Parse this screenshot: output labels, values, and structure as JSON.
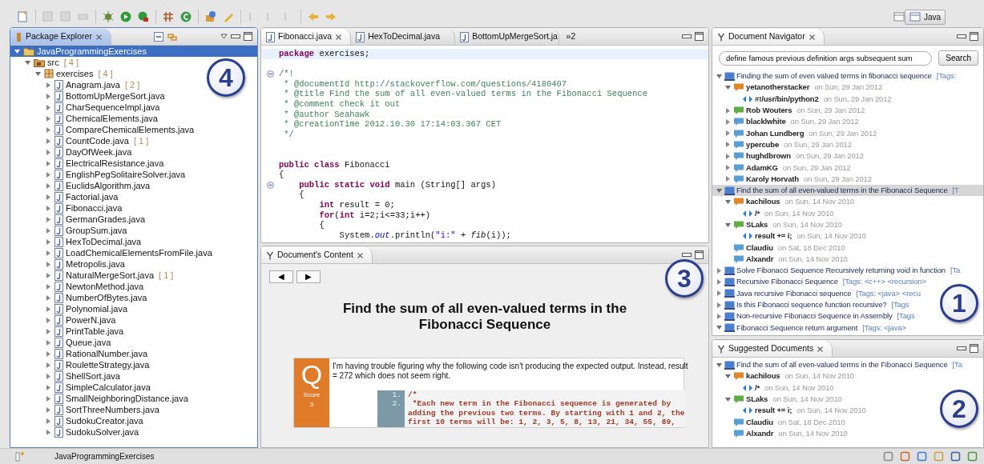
{
  "toolbar": {
    "perspective": "Java"
  },
  "package_explorer": {
    "title": "Package Explorer",
    "callout": "4",
    "tree": [
      {
        "kind": "project",
        "label": "JavaProgrammingExercises",
        "expanded": true,
        "selected": true,
        "children": [
          {
            "kind": "source-folder",
            "label": "src",
            "count": "[ 4 ]",
            "expanded": true,
            "selected": false,
            "children": [
              {
                "kind": "package",
                "label": "exercises",
                "count": "[ 4 ]",
                "expanded": true,
                "selected": false,
                "children": [
                  {
                    "kind": "java-file",
                    "label": "Anagram.java",
                    "count": "[ 2 ]",
                    "expanded": false,
                    "selected": false
                  },
                  {
                    "kind": "java-file",
                    "label": "BottomUpMergeSort.java",
                    "expanded": false,
                    "selected": false
                  },
                  {
                    "kind": "java-file",
                    "label": "CharSequenceImpl.java",
                    "expanded": false,
                    "selected": false
                  },
                  {
                    "kind": "java-file",
                    "label": "ChemicalElements.java",
                    "expanded": false,
                    "selected": false
                  },
                  {
                    "kind": "java-file",
                    "label": "CompareChemicalElements.java",
                    "expanded": false,
                    "selected": false
                  },
                  {
                    "kind": "java-file",
                    "label": "CountCode.java",
                    "count": "[ 1 ]",
                    "expanded": false,
                    "selected": false
                  },
                  {
                    "kind": "java-file",
                    "label": "DayOfWeek.java",
                    "expanded": false,
                    "selected": false
                  },
                  {
                    "kind": "java-file",
                    "label": "ElectricalResistance.java",
                    "expanded": false,
                    "selected": false
                  },
                  {
                    "kind": "java-file",
                    "label": "EnglishPegSolitaireSolver.java",
                    "expanded": false,
                    "selected": false
                  },
                  {
                    "kind": "java-file",
                    "label": "EuclidsAlgorithm.java",
                    "expanded": false,
                    "selected": false
                  },
                  {
                    "kind": "java-file",
                    "label": "Factorial.java",
                    "expanded": false,
                    "selected": false
                  },
                  {
                    "kind": "java-file",
                    "label": "Fibonacci.java",
                    "expanded": false,
                    "selected": false
                  },
                  {
                    "kind": "java-file",
                    "label": "GermanGrades.java",
                    "expanded": false,
                    "selected": false
                  },
                  {
                    "kind": "java-file",
                    "label": "GroupSum.java",
                    "expanded": false,
                    "selected": false
                  },
                  {
                    "kind": "java-file",
                    "label": "HexToDecimal.java",
                    "expanded": false,
                    "selected": false
                  },
                  {
                    "kind": "java-file",
                    "label": "LoadChemicalElementsFromFile.java",
                    "expanded": false,
                    "selected": false
                  },
                  {
                    "kind": "java-file",
                    "label": "Metropolis.java",
                    "expanded": false,
                    "selected": false
                  },
                  {
                    "kind": "java-file",
                    "label": "NaturalMergeSort.java",
                    "count": "[ 1 ]",
                    "expanded": false,
                    "selected": false
                  },
                  {
                    "kind": "java-file",
                    "label": "NewtonMethod.java",
                    "expanded": false,
                    "selected": false
                  },
                  {
                    "kind": "java-file",
                    "label": "NumberOfBytes.java",
                    "expanded": false,
                    "selected": false
                  },
                  {
                    "kind": "java-file",
                    "label": "Polynomial.java",
                    "expanded": false,
                    "selected": false
                  },
                  {
                    "kind": "java-file",
                    "label": "PowerN.java",
                    "expanded": false,
                    "selected": false
                  },
                  {
                    "kind": "java-file",
                    "label": "PrintTable.java",
                    "expanded": false,
                    "selected": false
                  },
                  {
                    "kind": "java-file",
                    "label": "Queue.java",
                    "expanded": false,
                    "selected": false
                  },
                  {
                    "kind": "java-file",
                    "label": "RationalNumber.java",
                    "expanded": false,
                    "selected": false
                  },
                  {
                    "kind": "java-file",
                    "label": "RouletteStrategy.java",
                    "expanded": false,
                    "selected": false
                  },
                  {
                    "kind": "java-file",
                    "label": "ShellSort.java",
                    "expanded": false,
                    "selected": false
                  },
                  {
                    "kind": "java-file",
                    "label": "SimpleCalculator.java",
                    "expanded": false,
                    "selected": false
                  },
                  {
                    "kind": "java-file",
                    "label": "SmallNeighboringDistance.java",
                    "expanded": false,
                    "selected": false
                  },
                  {
                    "kind": "java-file",
                    "label": "SortThreeNumbers.java",
                    "expanded": false,
                    "selected": false
                  },
                  {
                    "kind": "java-file",
                    "label": "SudokuCreator.java",
                    "expanded": false,
                    "selected": false
                  },
                  {
                    "kind": "java-file",
                    "label": "SudokuSolver.java",
                    "expanded": false,
                    "selected": false
                  }
                ]
              }
            ]
          }
        ]
      }
    ]
  },
  "editor": {
    "tabs": [
      {
        "label": "Fibonacci.java",
        "selected": true
      },
      {
        "label": "HexToDecimal.java",
        "selected": false
      },
      {
        "label": "BottomUpMergeSort.ja",
        "selected": false
      }
    ],
    "overflow": "»2",
    "lines": [
      {
        "kind": "code",
        "current": true,
        "segments": [
          {
            "kind": "keyword",
            "text": "package"
          },
          {
            "kind": "plain",
            "text": " exercises;"
          }
        ]
      },
      {
        "kind": "blank"
      },
      {
        "kind": "code",
        "foldable": true,
        "segments": [
          {
            "kind": "comment",
            "text": "/*!"
          }
        ]
      },
      {
        "kind": "code",
        "segments": [
          {
            "kind": "comment",
            "text": " * @documentId http://stackoverflow.com/questions/4180407"
          }
        ]
      },
      {
        "kind": "code",
        "segments": [
          {
            "kind": "comment",
            "text": " * @title Find the sum of all even-valued terms in the Fibonacci Sequence"
          }
        ]
      },
      {
        "kind": "code",
        "segments": [
          {
            "kind": "comment",
            "text": " * @comment check it out"
          }
        ]
      },
      {
        "kind": "code",
        "segments": [
          {
            "kind": "comment",
            "text": " * @author Seahawk"
          }
        ]
      },
      {
        "kind": "code",
        "segments": [
          {
            "kind": "comment",
            "text": " * @creationTime 2012.10.30 17:14:03.367 CET"
          }
        ]
      },
      {
        "kind": "code",
        "segments": [
          {
            "kind": "comment",
            "text": " */"
          }
        ]
      },
      {
        "kind": "blank"
      },
      {
        "kind": "blank"
      },
      {
        "kind": "code",
        "segments": [
          {
            "kind": "keyword",
            "text": "public class"
          },
          {
            "kind": "plain",
            "text": " Fibonacci"
          }
        ]
      },
      {
        "kind": "code",
        "segments": [
          {
            "kind": "plain",
            "text": "{"
          }
        ]
      },
      {
        "kind": "code",
        "foldable": true,
        "segments": [
          {
            "kind": "keyword",
            "text": "    public static void"
          },
          {
            "kind": "plain",
            "text": " main (String[] args)"
          }
        ]
      },
      {
        "kind": "code",
        "segments": [
          {
            "kind": "plain",
            "text": "    {"
          }
        ]
      },
      {
        "kind": "code",
        "segments": [
          {
            "kind": "keyword",
            "text": "        int"
          },
          {
            "kind": "plain",
            "text": " result = 0;"
          }
        ]
      },
      {
        "kind": "code",
        "segments": [
          {
            "kind": "keyword",
            "text": "        for"
          },
          {
            "kind": "plain",
            "text": "("
          },
          {
            "kind": "keyword",
            "text": "int"
          },
          {
            "kind": "plain",
            "text": " i=2;i<=33;i++)"
          }
        ]
      },
      {
        "kind": "code",
        "segments": [
          {
            "kind": "plain",
            "text": "        {"
          }
        ]
      },
      {
        "kind": "code",
        "segments": [
          {
            "kind": "plain",
            "text": "            System."
          },
          {
            "kind": "field",
            "text": "out"
          },
          {
            "kind": "plain",
            "text": ".println("
          },
          {
            "kind": "string",
            "text": "\"i:\""
          },
          {
            "kind": "plain",
            "text": " + "
          },
          {
            "kind": "method",
            "text": "fib"
          },
          {
            "kind": "plain",
            "text": "(i));"
          }
        ]
      }
    ]
  },
  "document_content": {
    "title": "Document's Content",
    "callout": "3",
    "nav_buttons": [
      "◀",
      "▶"
    ],
    "heading": "Find the sum of all even-valued terms in the Fibonacci Sequence",
    "question": {
      "badge": "Q",
      "score_label": "Score",
      "score": "3",
      "text": "I'm having trouble figuring why the following code isn't producing the expected output. Instead, result = 272 which does not seem right.",
      "code": [
        {
          "number": "1.",
          "text": "/*"
        },
        {
          "number": "2.",
          "text": " *Each new term in the Fibonacci sequence is generated by adding the previous two terms. By starting with 1 and 2, the first 10 terms will be: 1, 2, 3, 5, 8, 13, 21, 34, 55, 89,"
        }
      ]
    }
  },
  "document_navigator": {
    "title": "Document Navigator",
    "callout": "1",
    "search": {
      "value": "define famous previous definition args subsequent sum"
    },
    "search_button": "Search",
    "tree": [
      {
        "kind": "thread",
        "label": "Finding the sum of even valued terms in fibonacci sequence",
        "suffix": "[Tags:",
        "expanded": true,
        "selected": false,
        "children": [
          {
            "kind": "question-post",
            "label": "yetanotherstacker",
            "suffix": "on Sun, 29 Jan 2012",
            "expanded": true,
            "children": [
              {
                "kind": "code-snippet",
                "label": "#!/usr/bin/python2",
                "suffix": "on Sun, 29 Jan 2012"
              }
            ]
          },
          {
            "kind": "accepted-answer",
            "label": "Rob Wouters",
            "suffix": "on Sun, 29 Jan 2012",
            "expanded": false
          },
          {
            "kind": "answer",
            "label": "blacklwhite",
            "suffix": "on Sun, 29 Jan 2012",
            "expanded": false
          },
          {
            "kind": "answer",
            "label": "Johan Lundberg",
            "suffix": "on Sun, 29 Jan 2012",
            "expanded": false
          },
          {
            "kind": "answer",
            "label": "ypercube",
            "suffix": "on Sun, 29 Jan 2012",
            "expanded": false
          },
          {
            "kind": "answer",
            "label": "hughdbrown",
            "suffix": "on Sun, 29 Jan 2012",
            "expanded": false
          },
          {
            "kind": "answer",
            "label": "AdamKG",
            "suffix": "on Sun, 29 Jan 2012",
            "expanded": false
          },
          {
            "kind": "answer",
            "label": "Karoly Horvath",
            "suffix": "on Sun, 29 Jan 2012",
            "expanded": false
          }
        ]
      },
      {
        "kind": "thread",
        "label": "Find the sum of all even-valued terms in the Fibonacci Sequence",
        "suffix": "[T",
        "expanded": true,
        "selected": true,
        "children": [
          {
            "kind": "question-post",
            "label": "kachilous",
            "suffix": "on Sun, 14 Nov 2010",
            "expanded": true,
            "children": [
              {
                "kind": "code-snippet",
                "label": "/*",
                "suffix": "on Sun, 14 Nov 2010"
              }
            ]
          },
          {
            "kind": "accepted-answer",
            "label": "SLaks",
            "suffix": "on Sun, 14 Nov 2010",
            "expanded": true,
            "children": [
              {
                "kind": "code-snippet",
                "label": "result += i;",
                "suffix": "on Sun, 14 Nov 2010"
              }
            ]
          },
          {
            "kind": "answer",
            "label": "Claudiu",
            "suffix": "on Sat, 18 Dec 2010"
          },
          {
            "kind": "answer",
            "label": "Alxandr",
            "suffix": "on Sun, 14 Nov 2010"
          }
        ]
      },
      {
        "kind": "thread",
        "label": "Solve Fibonacci Sequence Recursively returning void in function",
        "suffix": "[Ta",
        "expanded": false,
        "selected": false
      },
      {
        "kind": "thread",
        "label": "Recursive Fibonacci Sequence",
        "suffix": "[Tags: <c++> <recursion>",
        "expanded": false,
        "selected": false
      },
      {
        "kind": "thread",
        "label": "Java recursive Fibonacci sequence",
        "suffix": "[Tags: <java> <recu",
        "expanded": false,
        "selected": false
      },
      {
        "kind": "thread",
        "label": "Is this Fibonacci sequence function recursive?",
        "suffix": "[Tags",
        "expanded": false,
        "selected": false
      },
      {
        "kind": "thread",
        "label": "Non-recursive Fibonacci Sequence in Assembly",
        "suffix": "[Tags",
        "expanded": false,
        "selected": false
      },
      {
        "kind": "thread",
        "label": "Fibonacci Sequence return argument",
        "suffix": "[Tags: <java>",
        "expanded": true,
        "selected": false
      }
    ]
  },
  "suggested_documents": {
    "title": "Suggested Documents",
    "callout": "2",
    "tree": [
      {
        "kind": "thread",
        "label": "Find the sum of all even-valued terms in the Fibonacci Sequence",
        "suffix": "[Ta",
        "expanded": true,
        "selected": false,
        "children": [
          {
            "kind": "question-post",
            "label": "kachilous",
            "suffix": "on Sun, 14 Nov 2010",
            "expanded": true,
            "children": [
              {
                "kind": "code-snippet",
                "label": "/*",
                "suffix": "on Sun, 14 Nov 2010"
              }
            ]
          },
          {
            "kind": "accepted-answer",
            "label": "SLaks",
            "suffix": "on Sun, 14 Nov 2010",
            "expanded": true,
            "children": [
              {
                "kind": "code-snippet",
                "label": "result += i;",
                "suffix": "on Sun, 14 Nov 2010"
              }
            ]
          },
          {
            "kind": "answer",
            "label": "Claudiu",
            "suffix": "on Sat, 18 Dec 2010"
          },
          {
            "kind": "answer",
            "label": "Alxandr",
            "suffix": "on Sun, 14 Nov 2010"
          }
        ]
      }
    ]
  },
  "status_bar": {
    "text": "JavaProgrammingExercises"
  }
}
